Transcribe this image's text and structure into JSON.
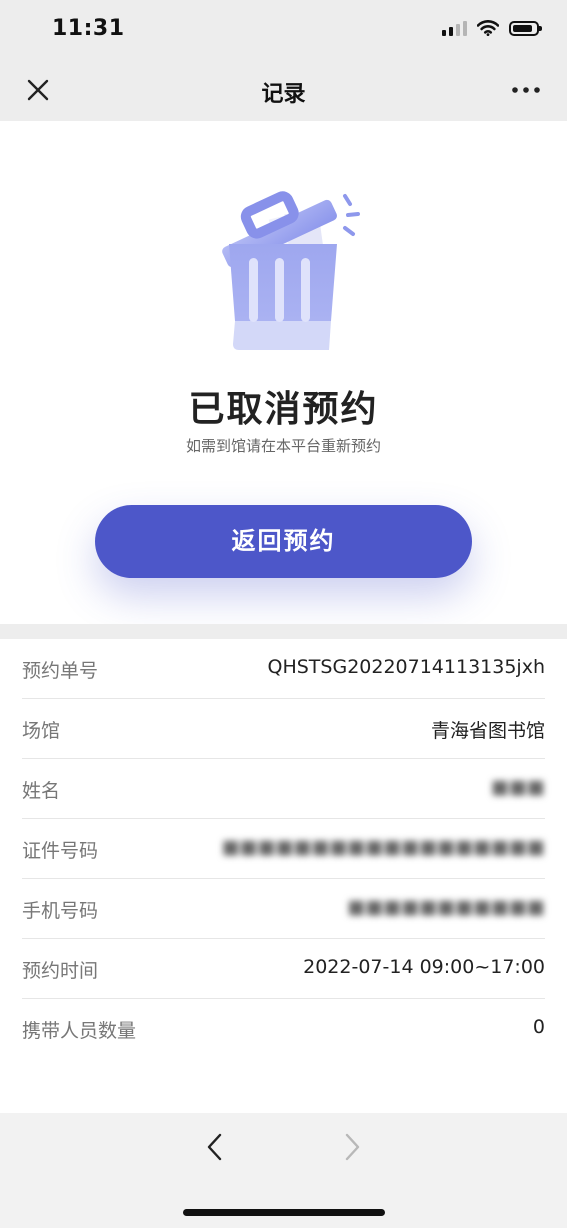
{
  "status_bar": {
    "time": "11:31"
  },
  "nav": {
    "title": "记录",
    "close_icon": "close-icon",
    "more_icon": "more-icon"
  },
  "hero": {
    "icon": "trash-bin-icon",
    "title": "已取消预约",
    "subtitle": "如需到馆请在本平台重新预约",
    "button_label": "返回预约"
  },
  "details": {
    "rows": [
      {
        "label": "预约单号",
        "value": "QHSTSG20220714113135jxh",
        "blurred": false
      },
      {
        "label": "场馆",
        "value": "青海省图书馆",
        "blurred": false
      },
      {
        "label": "姓名",
        "value": "",
        "blurred": true
      },
      {
        "label": "证件号码",
        "value": "",
        "blurred": true
      },
      {
        "label": "手机号码",
        "value": "",
        "blurred": true
      },
      {
        "label": "预约时间",
        "value": "2022-07-14 09:00~17:00",
        "blurred": false
      },
      {
        "label": "携带人员数量",
        "value": "0",
        "blurred": false
      }
    ]
  },
  "bottom_bar": {
    "back_icon": "chevron-left-icon",
    "forward_icon": "chevron-right-icon"
  },
  "colors": {
    "accent": "#4d57c9",
    "trash_light": "#c9cff7",
    "trash_mid": "#a3acf1"
  }
}
